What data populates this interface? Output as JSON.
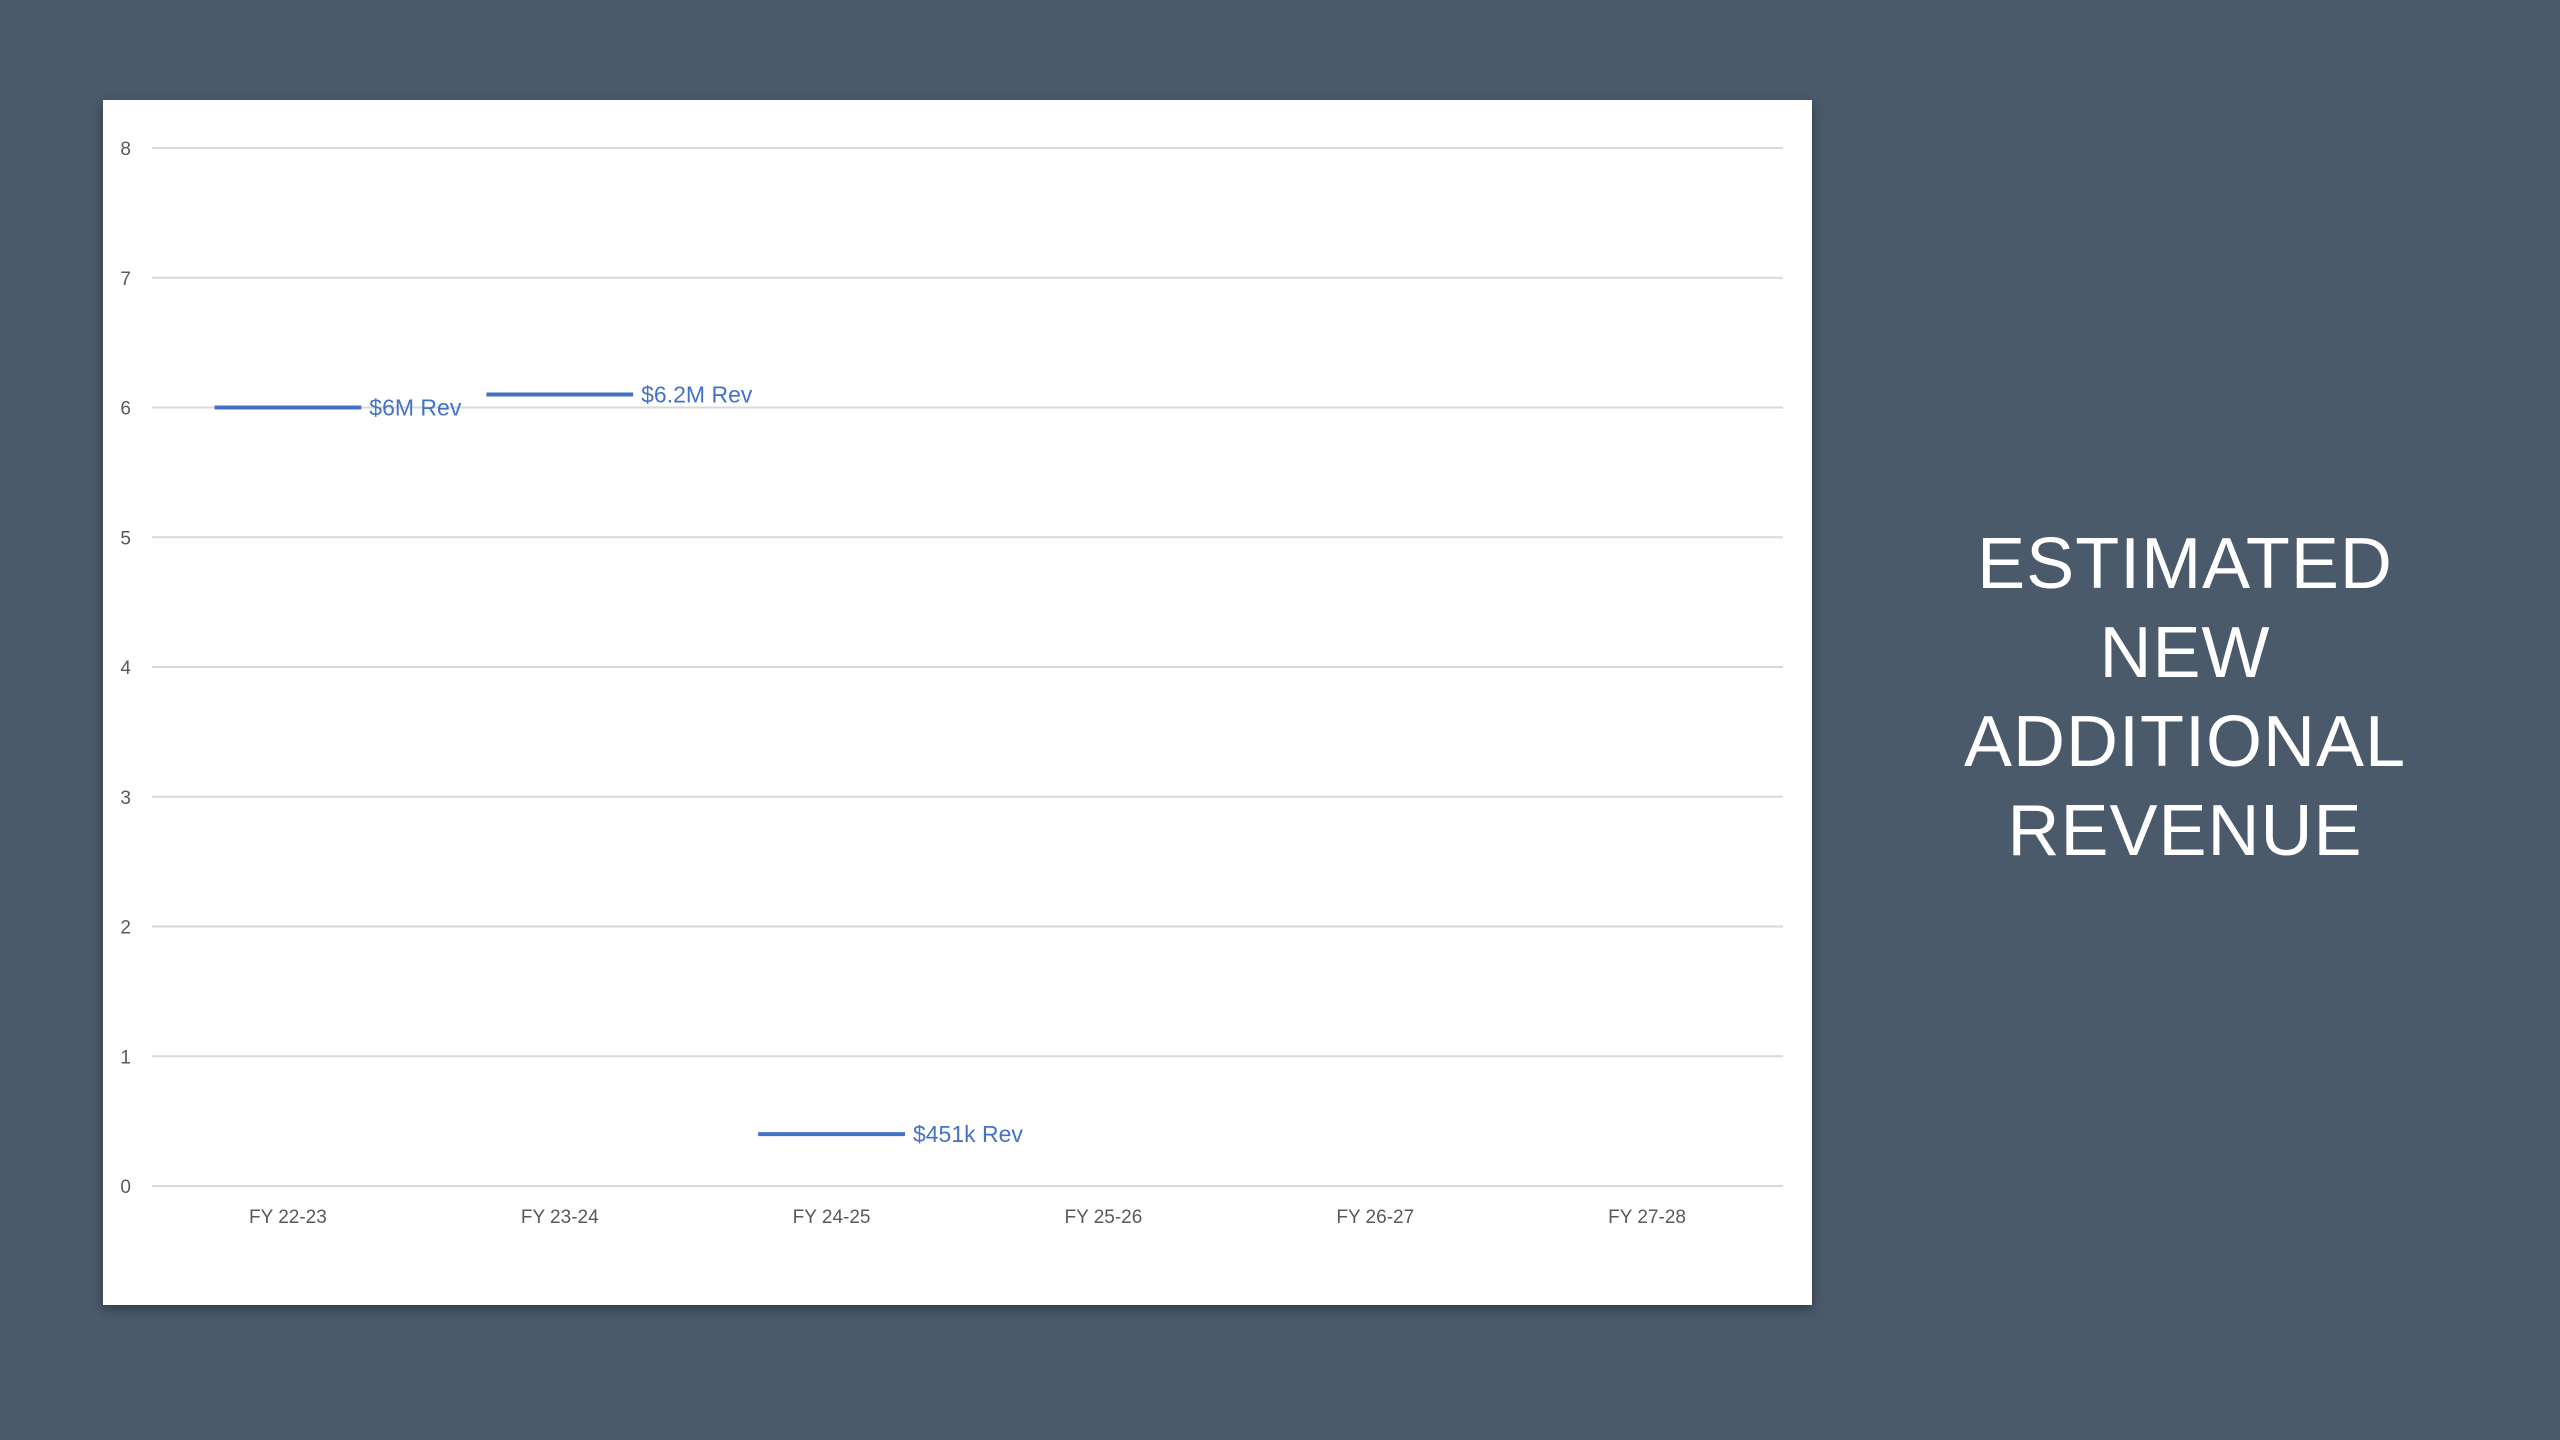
{
  "slide": {
    "title_lines": [
      "ESTIMATED",
      "NEW",
      "ADDITIONAL",
      "REVENUE"
    ]
  },
  "colors": {
    "background": "#4a5a6a",
    "series": "#4472c4",
    "gridline": "#d9d9d9",
    "tick_text": "#595959"
  },
  "chart_data": {
    "type": "line",
    "title": "",
    "xlabel": "",
    "ylabel": "",
    "categories": [
      "FY 22-23",
      "FY 23-24",
      "FY 24-25",
      "FY 25-26",
      "FY 26-27",
      "FY 27-28"
    ],
    "ylim": [
      0,
      8
    ],
    "yticks": [
      0,
      1,
      2,
      3,
      4,
      5,
      6,
      7,
      8
    ],
    "grid": true,
    "legend": "none",
    "series": [
      {
        "values": [
          6,
          6.1,
          0.4,
          null,
          null,
          null
        ],
        "data_labels": [
          "$6M Rev",
          "$6.2M Rev",
          "$451k Rev",
          null,
          null,
          null
        ]
      }
    ]
  }
}
